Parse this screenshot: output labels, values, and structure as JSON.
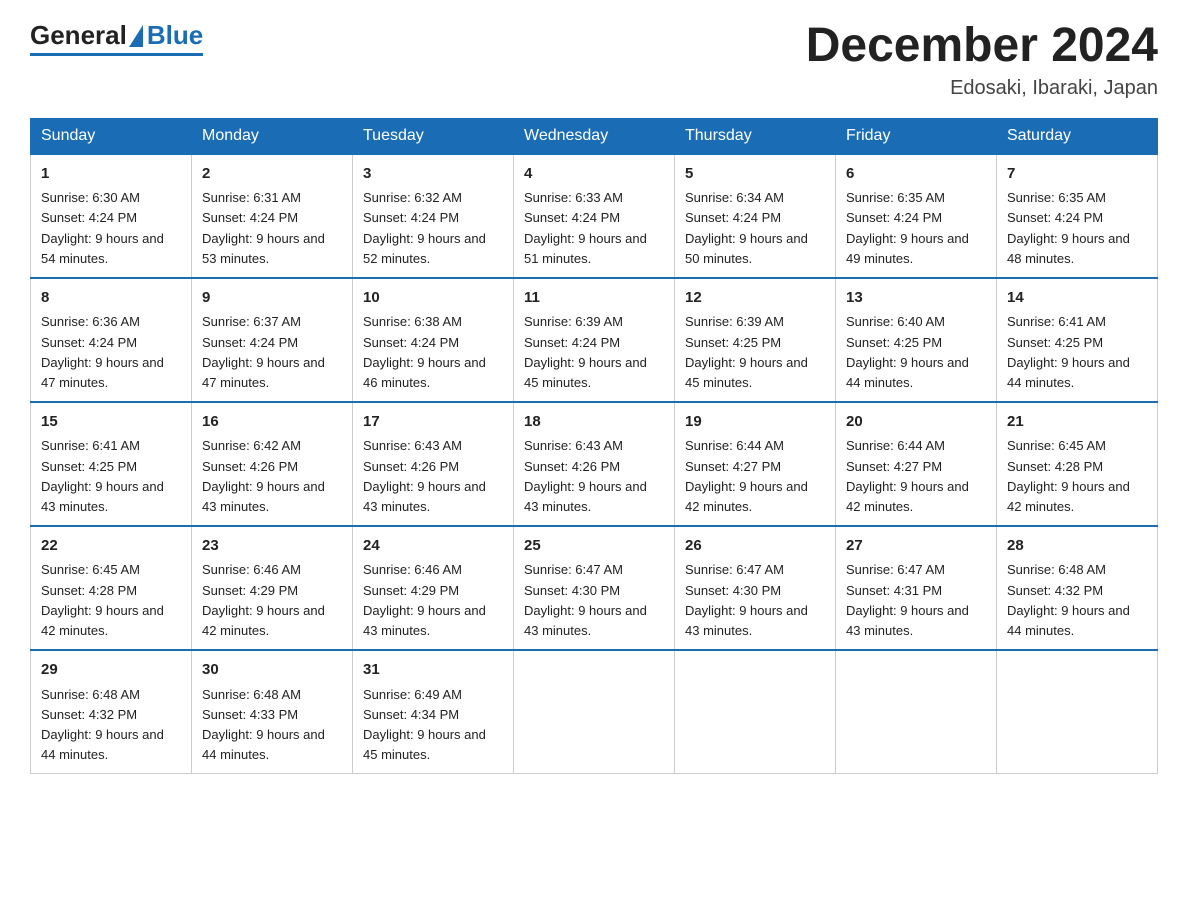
{
  "header": {
    "logo": {
      "general": "General",
      "blue": "Blue"
    },
    "title": "December 2024",
    "location": "Edosaki, Ibaraki, Japan"
  },
  "weekdays": [
    "Sunday",
    "Monday",
    "Tuesday",
    "Wednesday",
    "Thursday",
    "Friday",
    "Saturday"
  ],
  "weeks": [
    [
      {
        "day": "1",
        "sunrise": "6:30 AM",
        "sunset": "4:24 PM",
        "daylight": "9 hours and 54 minutes."
      },
      {
        "day": "2",
        "sunrise": "6:31 AM",
        "sunset": "4:24 PM",
        "daylight": "9 hours and 53 minutes."
      },
      {
        "day": "3",
        "sunrise": "6:32 AM",
        "sunset": "4:24 PM",
        "daylight": "9 hours and 52 minutes."
      },
      {
        "day": "4",
        "sunrise": "6:33 AM",
        "sunset": "4:24 PM",
        "daylight": "9 hours and 51 minutes."
      },
      {
        "day": "5",
        "sunrise": "6:34 AM",
        "sunset": "4:24 PM",
        "daylight": "9 hours and 50 minutes."
      },
      {
        "day": "6",
        "sunrise": "6:35 AM",
        "sunset": "4:24 PM",
        "daylight": "9 hours and 49 minutes."
      },
      {
        "day": "7",
        "sunrise": "6:35 AM",
        "sunset": "4:24 PM",
        "daylight": "9 hours and 48 minutes."
      }
    ],
    [
      {
        "day": "8",
        "sunrise": "6:36 AM",
        "sunset": "4:24 PM",
        "daylight": "9 hours and 47 minutes."
      },
      {
        "day": "9",
        "sunrise": "6:37 AM",
        "sunset": "4:24 PM",
        "daylight": "9 hours and 47 minutes."
      },
      {
        "day": "10",
        "sunrise": "6:38 AM",
        "sunset": "4:24 PM",
        "daylight": "9 hours and 46 minutes."
      },
      {
        "day": "11",
        "sunrise": "6:39 AM",
        "sunset": "4:24 PM",
        "daylight": "9 hours and 45 minutes."
      },
      {
        "day": "12",
        "sunrise": "6:39 AM",
        "sunset": "4:25 PM",
        "daylight": "9 hours and 45 minutes."
      },
      {
        "day": "13",
        "sunrise": "6:40 AM",
        "sunset": "4:25 PM",
        "daylight": "9 hours and 44 minutes."
      },
      {
        "day": "14",
        "sunrise": "6:41 AM",
        "sunset": "4:25 PM",
        "daylight": "9 hours and 44 minutes."
      }
    ],
    [
      {
        "day": "15",
        "sunrise": "6:41 AM",
        "sunset": "4:25 PM",
        "daylight": "9 hours and 43 minutes."
      },
      {
        "day": "16",
        "sunrise": "6:42 AM",
        "sunset": "4:26 PM",
        "daylight": "9 hours and 43 minutes."
      },
      {
        "day": "17",
        "sunrise": "6:43 AM",
        "sunset": "4:26 PM",
        "daylight": "9 hours and 43 minutes."
      },
      {
        "day": "18",
        "sunrise": "6:43 AM",
        "sunset": "4:26 PM",
        "daylight": "9 hours and 43 minutes."
      },
      {
        "day": "19",
        "sunrise": "6:44 AM",
        "sunset": "4:27 PM",
        "daylight": "9 hours and 42 minutes."
      },
      {
        "day": "20",
        "sunrise": "6:44 AM",
        "sunset": "4:27 PM",
        "daylight": "9 hours and 42 minutes."
      },
      {
        "day": "21",
        "sunrise": "6:45 AM",
        "sunset": "4:28 PM",
        "daylight": "9 hours and 42 minutes."
      }
    ],
    [
      {
        "day": "22",
        "sunrise": "6:45 AM",
        "sunset": "4:28 PM",
        "daylight": "9 hours and 42 minutes."
      },
      {
        "day": "23",
        "sunrise": "6:46 AM",
        "sunset": "4:29 PM",
        "daylight": "9 hours and 42 minutes."
      },
      {
        "day": "24",
        "sunrise": "6:46 AM",
        "sunset": "4:29 PM",
        "daylight": "9 hours and 43 minutes."
      },
      {
        "day": "25",
        "sunrise": "6:47 AM",
        "sunset": "4:30 PM",
        "daylight": "9 hours and 43 minutes."
      },
      {
        "day": "26",
        "sunrise": "6:47 AM",
        "sunset": "4:30 PM",
        "daylight": "9 hours and 43 minutes."
      },
      {
        "day": "27",
        "sunrise": "6:47 AM",
        "sunset": "4:31 PM",
        "daylight": "9 hours and 43 minutes."
      },
      {
        "day": "28",
        "sunrise": "6:48 AM",
        "sunset": "4:32 PM",
        "daylight": "9 hours and 44 minutes."
      }
    ],
    [
      {
        "day": "29",
        "sunrise": "6:48 AM",
        "sunset": "4:32 PM",
        "daylight": "9 hours and 44 minutes."
      },
      {
        "day": "30",
        "sunrise": "6:48 AM",
        "sunset": "4:33 PM",
        "daylight": "9 hours and 44 minutes."
      },
      {
        "day": "31",
        "sunrise": "6:49 AM",
        "sunset": "4:34 PM",
        "daylight": "9 hours and 45 minutes."
      },
      null,
      null,
      null,
      null
    ]
  ]
}
